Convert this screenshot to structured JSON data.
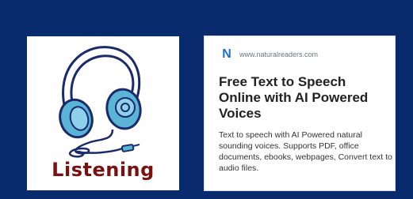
{
  "left_card": {
    "icon": "headphones-icon",
    "label": "Listening"
  },
  "ad": {
    "logo_letter": "N",
    "domain": "www.naturalreaders.com",
    "title": "Free Text to Speech Online with AI Powered Voices",
    "description": "Text to speech with AI Powered natural sounding voices. Supports PDF, office documents, ebooks, webpages, Convert text to audio files."
  },
  "colors": {
    "background": "#0a2a6e",
    "headphone_outline": "#1b2a6b",
    "headphone_fill": "#5ab4d6",
    "label": "#7a1010",
    "logo": "#1f6fd6"
  }
}
